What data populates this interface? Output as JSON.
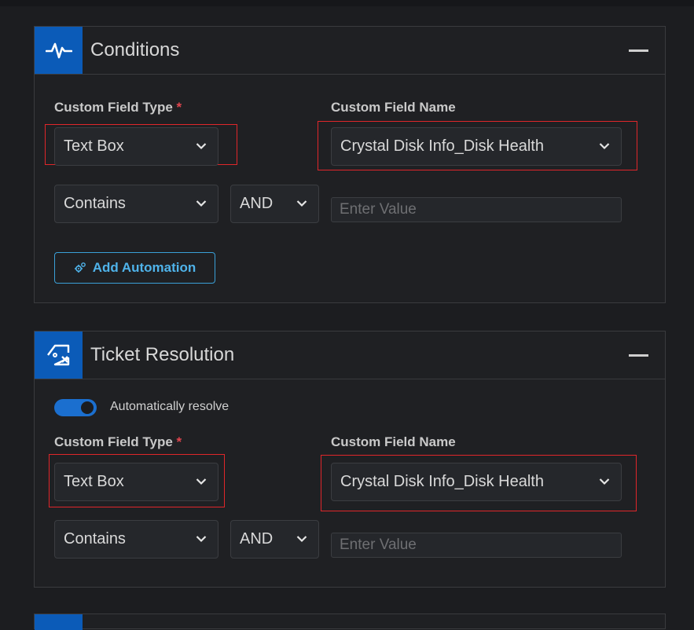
{
  "conditions": {
    "title": "Conditions",
    "icon": "pulse-icon",
    "custom_field_type_label": "Custom Field Type",
    "required_mark": "*",
    "custom_field_type_value": "Text Box",
    "custom_field_name_label": "Custom Field Name",
    "custom_field_name_value": "Crystal Disk Info_Disk Health",
    "operator_value": "Contains",
    "logic_value": "AND",
    "value_placeholder": "Enter Value",
    "add_automation_label": "Add Automation"
  },
  "ticket_resolution": {
    "title": "Ticket Resolution",
    "icon": "ticket-close-icon",
    "auto_resolve_label": "Automatically resolve",
    "auto_resolve_on": true,
    "custom_field_type_label": "Custom Field Type",
    "required_mark": "*",
    "custom_field_type_value": "Text Box",
    "custom_field_name_label": "Custom Field Name",
    "custom_field_name_value": "Crystal Disk Info_Disk Health",
    "operator_value": "Contains",
    "logic_value": "AND",
    "value_placeholder": "Enter Value"
  },
  "colors": {
    "accent_blue": "#0b5bb8",
    "link_blue": "#4fb3ea",
    "highlight_red": "#e0262a",
    "background": "#1c1d20"
  }
}
